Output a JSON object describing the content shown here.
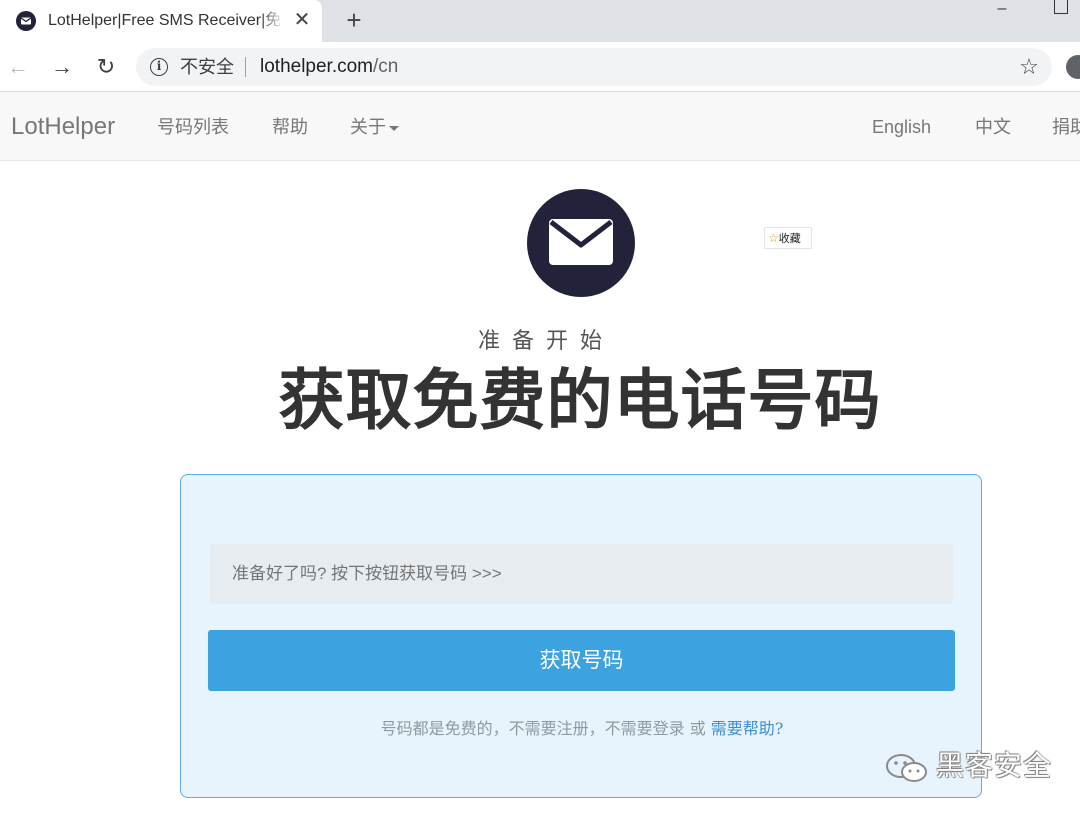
{
  "browser": {
    "tab_title": "LotHelper|Free SMS Receiver|免",
    "tab_close": "✕",
    "new_tab": "+",
    "back": "←",
    "forward": "→",
    "reload": "↻",
    "security_label": "不安全",
    "url_host": "lothelper.com",
    "url_path": "/cn",
    "bookmark": "☆",
    "window_minimize": "–"
  },
  "navbar": {
    "brand": "LotHelper",
    "links": {
      "numbers": "号码列表",
      "help": "帮助",
      "about": "关于"
    },
    "lang_english": "English",
    "lang_chinese": "中文",
    "donate": "捐助"
  },
  "hero": {
    "favorite_badge": "收藏",
    "favorite_star": "☆",
    "subtitle": "准备开始",
    "title": "获取免费的电话号码"
  },
  "panel": {
    "field_placeholder": "准备好了吗? 按下按钮获取号码 >>>",
    "button_label": "获取号码",
    "note_text": "号码都是免费的，不需要注册，不需要登录 或 ",
    "help_link": "需要帮助?"
  },
  "watermark": {
    "text": "黑客安全"
  },
  "colors": {
    "button": "#3ca3e0",
    "panel_bg": "#e8f4fd",
    "panel_border": "#5aaee3",
    "logo": "#22223a"
  }
}
